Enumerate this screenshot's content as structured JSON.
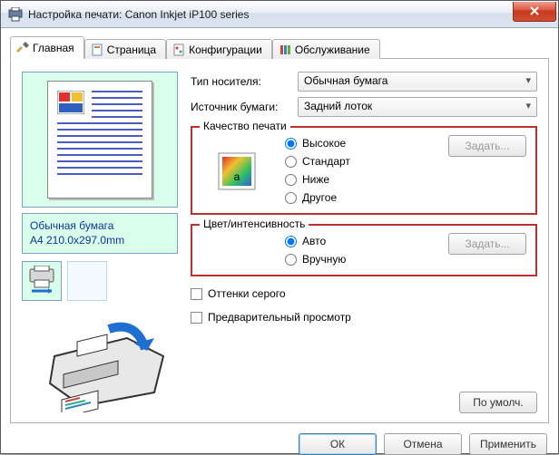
{
  "window": {
    "title": "Настройка печати: Canon Inkjet iP100 series"
  },
  "tabs": {
    "main": "Главная",
    "page": "Страница",
    "config": "Конфигурации",
    "maint": "Обслуживание"
  },
  "form": {
    "media_label": "Тип носителя:",
    "media_value": "Обычная бумага",
    "source_label": "Источник бумаги:",
    "source_value": "Задний лоток"
  },
  "quality": {
    "legend": "Качество печати",
    "opt_high": "Высокое",
    "opt_std": "Стандарт",
    "opt_low": "Ниже",
    "opt_custom": "Другое",
    "set_btn": "Задать..."
  },
  "color": {
    "legend": "Цвет/интенсивность",
    "opt_auto": "Авто",
    "opt_manual": "Вручную",
    "set_btn": "Задать..."
  },
  "checks": {
    "grayscale": "Оттенки серого",
    "preview": "Предварительный просмотр"
  },
  "buttons": {
    "defaults": "По умолч.",
    "ok": "ОК",
    "cancel": "Отмена",
    "apply": "Применить"
  },
  "preview": {
    "media": "Обычная бумага",
    "size": "A4 210.0x297.0mm"
  }
}
